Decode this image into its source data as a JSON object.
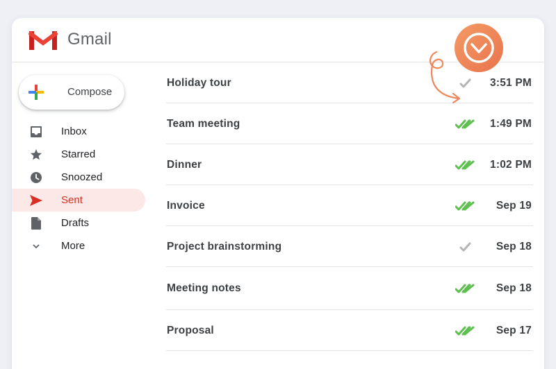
{
  "app": {
    "title": "Gmail"
  },
  "compose": {
    "label": "Compose"
  },
  "nav": [
    {
      "label": "Inbox",
      "icon": "inbox-icon",
      "active": false
    },
    {
      "label": "Starred",
      "icon": "star-icon",
      "active": false
    },
    {
      "label": "Snoozed",
      "icon": "clock-icon",
      "active": false
    },
    {
      "label": "Sent",
      "icon": "send-icon",
      "active": true
    },
    {
      "label": "Drafts",
      "icon": "draft-icon",
      "active": false
    },
    {
      "label": "More",
      "icon": "chevron-down-icon",
      "active": false
    }
  ],
  "emails": [
    {
      "subject": "Holiday tour",
      "time": "3:51 PM",
      "status": "sent"
    },
    {
      "subject": "Team meeting",
      "time": "1:49 PM",
      "status": "opened"
    },
    {
      "subject": "Dinner",
      "time": "1:02 PM",
      "status": "opened"
    },
    {
      "subject": "Invoice",
      "time": "Sep 19",
      "status": "opened"
    },
    {
      "subject": "Project brainstorming",
      "time": "Sep 18",
      "status": "sent"
    },
    {
      "subject": "Meeting notes",
      "time": "Sep 18",
      "status": "opened"
    },
    {
      "subject": "Proposal",
      "time": "Sep 17",
      "status": "opened"
    }
  ],
  "colors": {
    "accent_red": "#d93025",
    "active_bg": "#fce8e6",
    "check_grey": "#b4b4b4",
    "check_green": "#5cbf4e",
    "badge_orange": "#ef8659"
  }
}
